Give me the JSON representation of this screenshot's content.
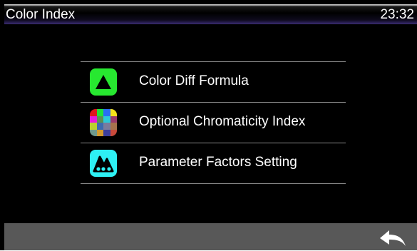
{
  "titlebar": {
    "title": "Color Index",
    "clock": "23:32"
  },
  "menu": {
    "items": [
      {
        "label": "Color Diff Formula",
        "icon": "triangle-icon"
      },
      {
        "label": "Optional Chromaticity Index",
        "icon": "color-mosaic-icon"
      },
      {
        "label": "Parameter Factors Setting",
        "icon": "parameter-factors-icon"
      }
    ]
  },
  "footer": {
    "back_icon": "back-arrow-icon"
  },
  "colors": {
    "title_gradient_end": "#3a2c72",
    "green_icon": "#27e830",
    "cyan_icon": "#2ef0f4",
    "footer_bar": "#585858",
    "mosaic": [
      "#e0161d",
      "#1ee33a",
      "#2a6df3",
      "#f4e21b",
      "#e61adc",
      "#5c8f55",
      "#2dc9d8",
      "#9a3b6c",
      "#b9d12f",
      "#3c6bb0",
      "#7b7b9c",
      "#a7734d",
      "#6e9a8d",
      "#d29a2e",
      "#3b3f9e",
      "#c94a3b"
    ]
  }
}
